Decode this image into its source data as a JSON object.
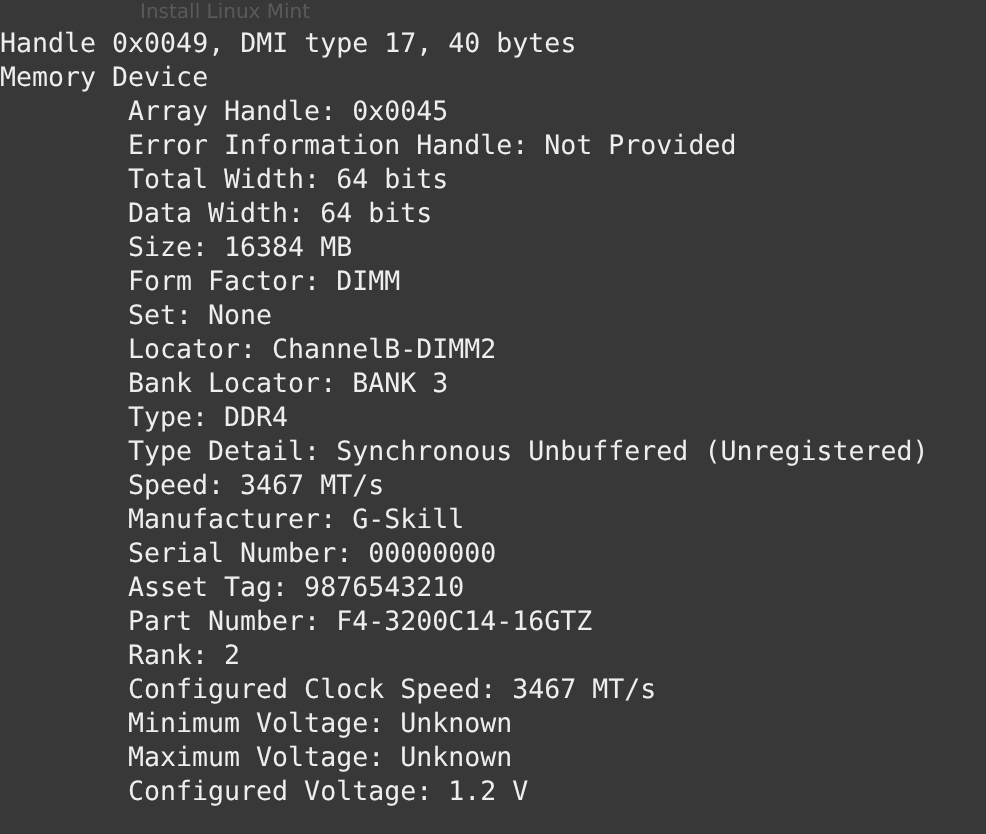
{
  "desktop_label": "Install Linux Mint",
  "terminal": {
    "header": "Handle 0x0049, DMI type 17, 40 bytes",
    "section": "Memory Device",
    "lines": [
      "Array Handle: 0x0045",
      "Error Information Handle: Not Provided",
      "Total Width: 64 bits",
      "Data Width: 64 bits",
      "Size: 16384 MB",
      "Form Factor: DIMM",
      "Set: None",
      "Locator: ChannelB-DIMM2",
      "Bank Locator: BANK 3",
      "Type: DDR4",
      "Type Detail: Synchronous Unbuffered (Unregistered)",
      "Speed: 3467 MT/s",
      "Manufacturer: G-Skill",
      "Serial Number: 00000000",
      "Asset Tag: 9876543210",
      "Part Number: F4-3200C14-16GTZ",
      "Rank: 2",
      "Configured Clock Speed: 3467 MT/s",
      "Minimum Voltage: Unknown",
      "Maximum Voltage: Unknown",
      "Configured Voltage: 1.2 V"
    ]
  }
}
